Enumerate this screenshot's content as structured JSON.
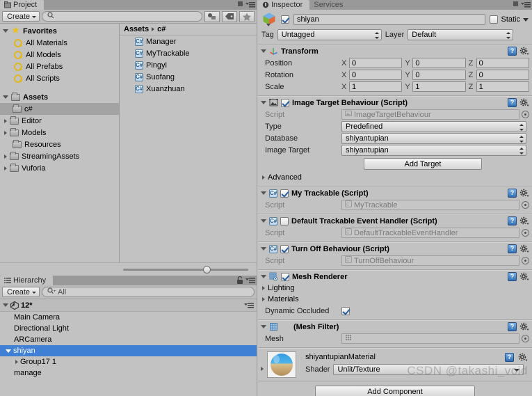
{
  "project_panel": {
    "tab_label": "Project",
    "toolbar": {
      "create_label": "Create",
      "search_placeholder": "",
      "search_value": "",
      "filter_icons": [
        "shapes-filter-icon",
        "label-filter-icon",
        "favorite-filter-icon"
      ]
    },
    "tree": [
      {
        "label": "Favorites",
        "icon": "star-icon",
        "depth": 0,
        "expanded": true,
        "bold": true
      },
      {
        "label": "All Materials",
        "icon": "search-icon",
        "depth": 1,
        "bold": false
      },
      {
        "label": "All Models",
        "icon": "search-icon",
        "depth": 1,
        "bold": false
      },
      {
        "label": "All Prefabs",
        "icon": "search-icon",
        "depth": 1,
        "bold": false
      },
      {
        "label": "All Scripts",
        "icon": "search-icon",
        "depth": 1,
        "bold": false
      },
      {
        "label": "Assets",
        "icon": "folder-icon",
        "depth": 0,
        "expanded": true,
        "bold": true
      },
      {
        "label": "c#",
        "icon": "folder-icon",
        "depth": 1,
        "selected": true,
        "bold": false
      },
      {
        "label": "Editor",
        "icon": "folder-icon",
        "depth": 1,
        "collapsed": true,
        "bold": false
      },
      {
        "label": "Models",
        "icon": "folder-icon",
        "depth": 1,
        "collapsed": true,
        "bold": false
      },
      {
        "label": "Resources",
        "icon": "folder-icon",
        "depth": 1,
        "bold": false
      },
      {
        "label": "StreamingAssets",
        "icon": "folder-icon",
        "depth": 1,
        "collapsed": true,
        "bold": false
      },
      {
        "label": "Vuforia",
        "icon": "folder-icon",
        "depth": 1,
        "collapsed": true,
        "bold": false
      }
    ],
    "breadcrumb": {
      "root": "Assets",
      "current": "c#"
    },
    "assets": [
      {
        "label": "Manager",
        "icon": "csharp-script-icon"
      },
      {
        "label": "MyTrackable",
        "icon": "csharp-script-icon"
      },
      {
        "label": "Pingyi",
        "icon": "csharp-script-icon"
      },
      {
        "label": "Suofang",
        "icon": "csharp-script-icon"
      },
      {
        "label": "Xuanzhuan",
        "icon": "csharp-script-icon"
      }
    ],
    "zoom_slider_percent": 64
  },
  "hierarchy_panel": {
    "tab_label": "Hierarchy",
    "create_label": "Create",
    "search_value": "All",
    "scene_name": "12*",
    "items": [
      {
        "label": "Main Camera",
        "depth": 1,
        "has_children": false,
        "selected": false
      },
      {
        "label": "Directional Light",
        "depth": 1,
        "has_children": false,
        "selected": false
      },
      {
        "label": "ARCamera",
        "depth": 1,
        "has_children": false,
        "selected": false
      },
      {
        "label": "shiyan",
        "depth": 1,
        "has_children": true,
        "expanded": true,
        "selected": true
      },
      {
        "label": "Group17 1",
        "depth": 2,
        "has_children": true,
        "expanded": false,
        "selected": false
      },
      {
        "label": "manage",
        "depth": 1,
        "has_children": false,
        "selected": false
      }
    ]
  },
  "inspector_panel": {
    "tabs": [
      {
        "label": "Inspector",
        "active": true,
        "icon": "inspector-icon"
      },
      {
        "label": "Services",
        "active": false,
        "icon": ""
      }
    ],
    "game_object": {
      "enabled": true,
      "name": "shiyan",
      "static_label": "Static",
      "static_checked": false,
      "tag_label": "Tag",
      "tag_value": "Untagged",
      "layer_label": "Layer",
      "layer_value": "Default"
    },
    "transform": {
      "title": "Transform",
      "expanded": true,
      "rows": [
        {
          "label": "Position",
          "x": "0",
          "y": "0",
          "z": "0"
        },
        {
          "label": "Rotation",
          "x": "0",
          "y": "0",
          "z": "0"
        },
        {
          "label": "Scale",
          "x": "1",
          "y": "1",
          "z": "1"
        }
      ],
      "axis_labels": [
        "X",
        "Y",
        "Z"
      ]
    },
    "image_target": {
      "title": "Image Target Behaviour (Script)",
      "enabled": true,
      "script_label": "Script",
      "script_value": "ImageTargetBehaviour",
      "type_label": "Type",
      "type_value": "Predefined",
      "database_label": "Database",
      "database_value": "shiyantupian",
      "image_target_label": "Image Target",
      "image_target_value": "shiyantupian",
      "add_target_label": "Add Target",
      "advanced_label": "Advanced"
    },
    "my_trackable": {
      "title": "My Trackable (Script)",
      "enabled": true,
      "script_label": "Script",
      "script_value": "MyTrackable"
    },
    "default_trackable_event_handler": {
      "title": "Default Trackable Event Handler (Script)",
      "enabled": false,
      "script_label": "Script",
      "script_value": "DefaultTrackableEventHandler"
    },
    "turn_off_behaviour": {
      "title": "Turn Off Behaviour (Script)",
      "enabled": true,
      "script_label": "Script",
      "script_value": "TurnOffBehaviour"
    },
    "mesh_renderer": {
      "title": "Mesh Renderer",
      "enabled": true,
      "lighting_label": "Lighting",
      "materials_label": "Materials",
      "dynamic_occluded_label": "Dynamic Occluded",
      "dynamic_occluded_checked": true
    },
    "mesh_filter": {
      "title": "(Mesh Filter)",
      "mesh_label": "Mesh",
      "mesh_value": ""
    },
    "material": {
      "name": "shiyantupianMaterial",
      "shader_label": "Shader",
      "shader_value": "Unlit/Texture"
    },
    "add_component_label": "Add Component"
  },
  "watermark": "CSDN @takashi_void",
  "colors": {
    "panel_bg": "#c2c2c2",
    "tabbar_bg": "#999999",
    "selection_blue": "#3f7fd4",
    "selection_gray": "#a3a3a3",
    "checkbox_check": "#2a5d9e"
  }
}
